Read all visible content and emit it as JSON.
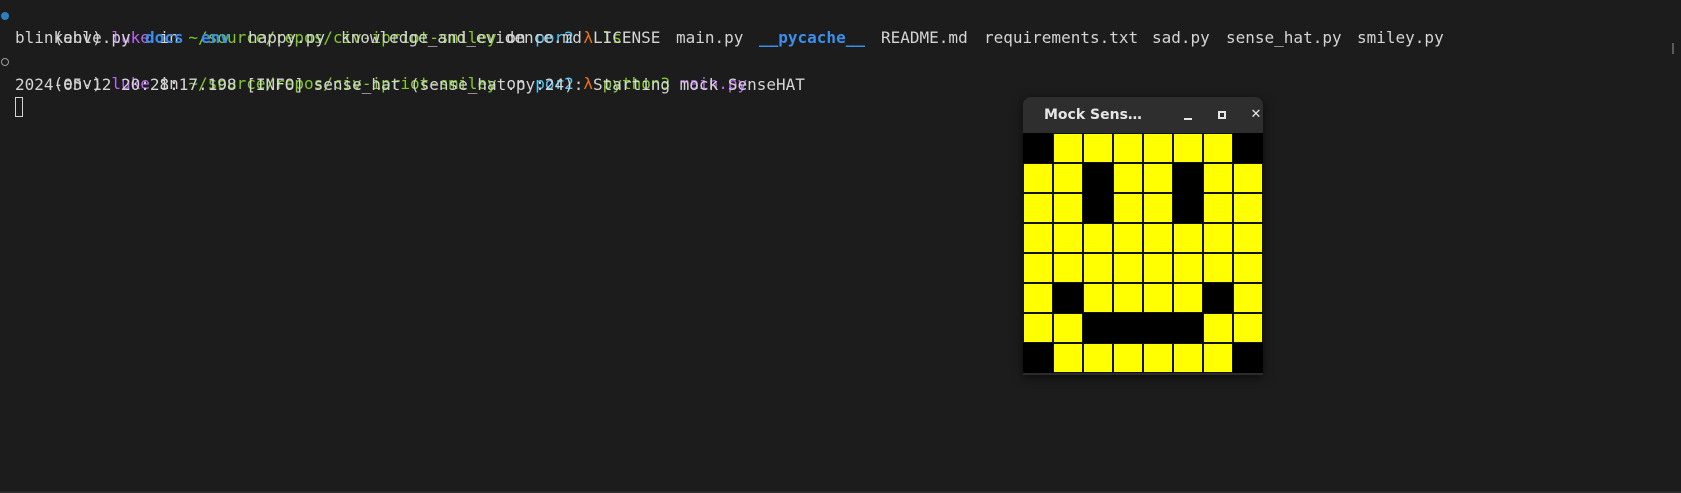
{
  "terminal": {
    "line1": {
      "env": "(env)",
      "user": "luke",
      "in": "in",
      "path": "~/source/repos/civ-ipriot-smiley",
      "on": "on",
      "branch": "por2",
      "lambda": "λ",
      "command": "ls",
      "args": ""
    },
    "ls_output": [
      {
        "name": "blinkable.py",
        "type": "file"
      },
      {
        "name": "docs",
        "type": "dir"
      },
      {
        "name": "env",
        "type": "dir"
      },
      {
        "name": "happy.py",
        "type": "file"
      },
      {
        "name": "knowledge_and_evidence.md",
        "type": "file"
      },
      {
        "name": "LICENSE",
        "type": "file"
      },
      {
        "name": "main.py",
        "type": "file"
      },
      {
        "name": "__pycache__",
        "type": "dir"
      },
      {
        "name": "README.md",
        "type": "file"
      },
      {
        "name": "requirements.txt",
        "type": "file"
      },
      {
        "name": "sad.py",
        "type": "file"
      },
      {
        "name": "sense_hat.py",
        "type": "file"
      },
      {
        "name": "smiley.py",
        "type": "file"
      }
    ],
    "line3": {
      "env": "(env)",
      "user": "luke",
      "in": "in",
      "path": "~/source/repos/civ-ipriot-smiley",
      "on": "on",
      "branch": "por2",
      "lambda": "λ",
      "command": "python3",
      "args": "main.py"
    },
    "log_line": "2024-05-12 20:28:17.198 [INFO] sense_hat (sense_hat.py:24): Starting mock SenseHAT"
  },
  "mock_window": {
    "title": "Mock Sens…",
    "close_glyph": "✕",
    "led_on_color": "#ffff00",
    "led_off_color": "#000000",
    "matrix": [
      [
        0,
        1,
        1,
        1,
        1,
        1,
        1,
        0
      ],
      [
        1,
        1,
        0,
        1,
        1,
        0,
        1,
        1
      ],
      [
        1,
        1,
        0,
        1,
        1,
        0,
        1,
        1
      ],
      [
        1,
        1,
        1,
        1,
        1,
        1,
        1,
        1
      ],
      [
        1,
        1,
        1,
        1,
        1,
        1,
        1,
        1
      ],
      [
        1,
        0,
        1,
        1,
        1,
        1,
        0,
        1
      ],
      [
        1,
        1,
        0,
        0,
        0,
        0,
        1,
        1
      ],
      [
        0,
        1,
        1,
        1,
        1,
        1,
        1,
        0
      ]
    ]
  },
  "colors": {
    "background": "#1c1c1c",
    "user": "#b667ee",
    "path": "#7ec92b",
    "branch": "#4fc3f7",
    "lambda": "#e8731f",
    "directory": "#3b8eea"
  }
}
